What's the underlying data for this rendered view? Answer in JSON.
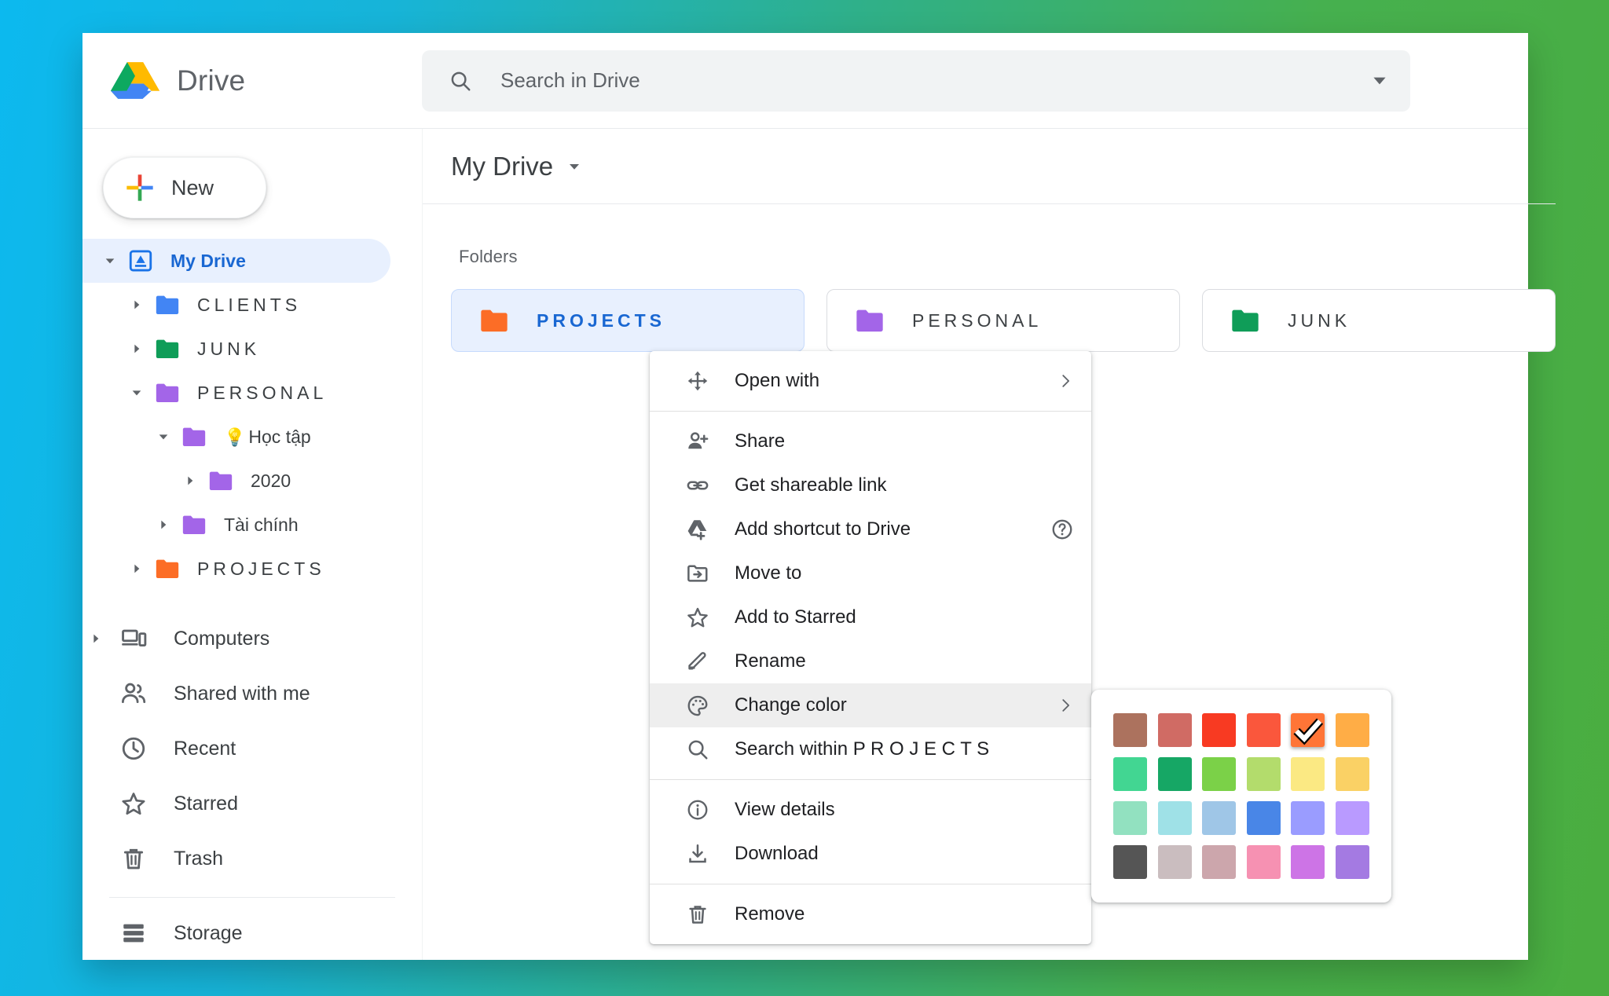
{
  "brand": {
    "name": "Drive",
    "logo_icon": "drive-logo-icon"
  },
  "search": {
    "placeholder": "Search in Drive",
    "value": "",
    "icon": "search-icon",
    "options_icon": "chevron-down-icon"
  },
  "sidebar": {
    "new_button": {
      "label": "New",
      "icon": "plus-icon"
    },
    "tree": [
      {
        "label": "My Drive",
        "icon": "my-drive-icon",
        "color": "#1a73e8",
        "caret": "down",
        "indent": 0,
        "active": true,
        "spaced": false,
        "emoji": ""
      },
      {
        "label": "CLIENTS",
        "icon": "folder-icon",
        "color": "#4285f4",
        "caret": "right",
        "indent": 1,
        "active": false,
        "spaced": true,
        "emoji": ""
      },
      {
        "label": "JUNK",
        "icon": "folder-icon",
        "color": "#0f9d58",
        "caret": "right",
        "indent": 1,
        "active": false,
        "spaced": true,
        "emoji": ""
      },
      {
        "label": "PERSONAL",
        "icon": "folder-icon",
        "color": "#a365e8",
        "caret": "down",
        "indent": 1,
        "active": false,
        "spaced": true,
        "emoji": ""
      },
      {
        "label": "Học tập",
        "icon": "folder-icon",
        "color": "#a365e8",
        "caret": "down",
        "indent": 2,
        "active": false,
        "spaced": false,
        "emoji": "💡"
      },
      {
        "label": "2020",
        "icon": "folder-icon",
        "color": "#a365e8",
        "caret": "right",
        "indent": 3,
        "active": false,
        "spaced": false,
        "emoji": ""
      },
      {
        "label": "Tài chính",
        "icon": "folder-icon",
        "color": "#a365e8",
        "caret": "right",
        "indent": 2,
        "active": false,
        "spaced": false,
        "emoji": ""
      },
      {
        "label": "PROJECTS",
        "icon": "folder-icon",
        "color": "#fc6d26",
        "caret": "right",
        "indent": 1,
        "active": false,
        "spaced": true,
        "emoji": ""
      }
    ],
    "nav": [
      {
        "label": "Computers",
        "icon": "computers-icon",
        "caret": "right"
      },
      {
        "label": "Shared with me",
        "icon": "people-icon",
        "caret": "none"
      },
      {
        "label": "Recent",
        "icon": "clock-icon",
        "caret": "none"
      },
      {
        "label": "Starred",
        "icon": "star-icon",
        "caret": "none"
      },
      {
        "label": "Trash",
        "icon": "trash-icon",
        "caret": "none"
      }
    ],
    "storage": {
      "label": "Storage",
      "icon": "storage-icon"
    }
  },
  "main": {
    "title": "My Drive",
    "title_caret_icon": "caret-down-icon",
    "section_label": "Folders",
    "folders": [
      {
        "name": "PROJECTS",
        "color": "#fc6d26",
        "selected": true
      },
      {
        "name": "PERSONAL",
        "color": "#a365e8",
        "selected": false
      },
      {
        "name": "JUNK",
        "color": "#0f9d58",
        "selected": false
      }
    ]
  },
  "context_menu": {
    "items": [
      {
        "label": "Open with",
        "icon": "move-arrows-icon",
        "submenu": true,
        "hovered": false,
        "help": false,
        "sep_after": true
      },
      {
        "label": "Share",
        "icon": "person-add-icon",
        "submenu": false,
        "hovered": false,
        "help": false,
        "sep_after": false
      },
      {
        "label": "Get shareable link",
        "icon": "link-icon",
        "submenu": false,
        "hovered": false,
        "help": false,
        "sep_after": false
      },
      {
        "label": "Add shortcut to Drive",
        "icon": "drive-add-icon",
        "submenu": false,
        "hovered": false,
        "help": true,
        "sep_after": false
      },
      {
        "label": "Move to",
        "icon": "folder-move-icon",
        "submenu": false,
        "hovered": false,
        "help": false,
        "sep_after": false
      },
      {
        "label": "Add to Starred",
        "icon": "star-icon",
        "submenu": false,
        "hovered": false,
        "help": false,
        "sep_after": false
      },
      {
        "label": "Rename",
        "icon": "pencil-icon",
        "submenu": false,
        "hovered": false,
        "help": false,
        "sep_after": false
      },
      {
        "label": "Change color",
        "icon": "palette-icon",
        "submenu": true,
        "hovered": true,
        "help": false,
        "sep_after": false
      },
      {
        "label": "Search within P R O J E C T S",
        "icon": "search-icon",
        "submenu": false,
        "hovered": false,
        "help": false,
        "sep_after": true
      },
      {
        "label": "View details",
        "icon": "info-icon",
        "submenu": false,
        "hovered": false,
        "help": false,
        "sep_after": false
      },
      {
        "label": "Download",
        "icon": "download-icon",
        "submenu": false,
        "hovered": false,
        "help": false,
        "sep_after": true
      },
      {
        "label": "Remove",
        "icon": "trash-icon",
        "submenu": false,
        "hovered": false,
        "help": false,
        "sep_after": false
      }
    ]
  },
  "color_palette": {
    "selected_index": 4,
    "swatches": [
      "#ac725e",
      "#d06b64",
      "#f83a22",
      "#fa573c",
      "#ff7537",
      "#ffad46",
      "#42d692",
      "#16a765",
      "#7bd148",
      "#b3dc6c",
      "#fbe983",
      "#fad165",
      "#92e1c0",
      "#9fe1e7",
      "#9fc6e7",
      "#4986e7",
      "#9a9cff",
      "#b99aff",
      "#555555",
      "#cabdbf",
      "#cca6ac",
      "#f691b2",
      "#cd74e6",
      "#a47ae2"
    ]
  }
}
